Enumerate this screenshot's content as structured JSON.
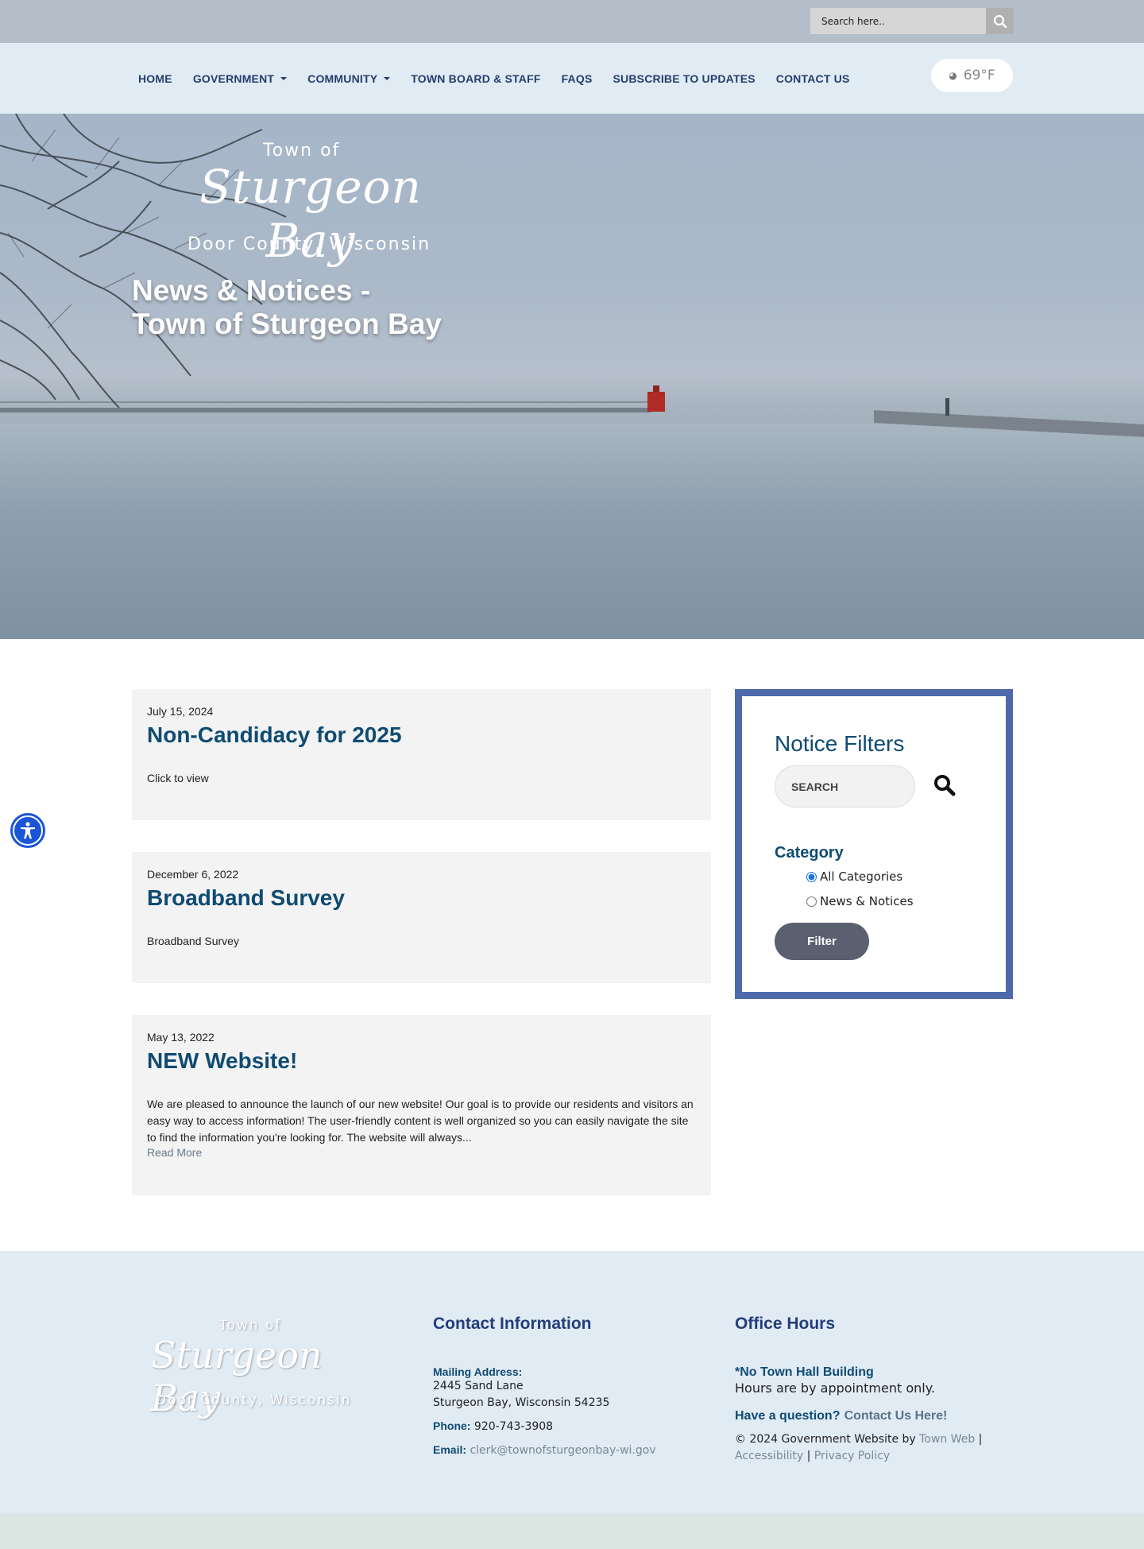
{
  "topbar": {
    "search_placeholder": "Search here.."
  },
  "nav": {
    "items": [
      {
        "label": "HOME",
        "dropdown": false
      },
      {
        "label": "GOVERNMENT",
        "dropdown": true
      },
      {
        "label": "COMMUNITY",
        "dropdown": true
      },
      {
        "label": "TOWN BOARD & STAFF",
        "dropdown": false
      },
      {
        "label": "FAQS",
        "dropdown": false
      },
      {
        "label": "SUBSCRIBE TO UPDATES",
        "dropdown": false
      },
      {
        "label": "CONTACT US",
        "dropdown": false
      }
    ],
    "weather": "69°F"
  },
  "hero": {
    "logo_town": "Town of",
    "logo_script": "Sturgeon Bay",
    "logo_county": "Door County, Wisconsin",
    "title_line1": "News & Notices -",
    "title_line2": "Town of Sturgeon Bay"
  },
  "posts": [
    {
      "date": "July 15, 2024",
      "title": "Non-Candidacy for 2025",
      "excerpt": "Click to view",
      "read_more": ""
    },
    {
      "date": "December 6, 2022",
      "title": "Broadband Survey",
      "excerpt": "Broadband Survey",
      "read_more": ""
    },
    {
      "date": "May 13, 2022",
      "title": "NEW Website!",
      "excerpt": "We are pleased to announce the launch of our new website! Our goal is to provide our residents and visitors an easy way to access information! The user-friendly content is well organized so you can easily navigate the site to find the information you're looking for. The website will always...",
      "read_more": "Read More"
    }
  ],
  "filters": {
    "title": "Notice Filters",
    "search_placeholder": "SEARCH",
    "category_label": "Category",
    "options": [
      {
        "label": "All Categories",
        "checked": true
      },
      {
        "label": "News & Notices",
        "checked": false
      }
    ],
    "button": "Filter"
  },
  "footer": {
    "logo_town": "Town of",
    "logo_script": "Sturgeon Bay",
    "logo_county": "Door County, Wisconsin",
    "contact": {
      "heading": "Contact Information",
      "mailing_label": "Mailing Address:",
      "address_line1": "2445 Sand Lane",
      "address_line2": "Sturgeon Bay, Wisconsin 54235",
      "phone_label": "Phone:",
      "phone": "920-743-3908",
      "email_label": "Email:",
      "email": "clerk@townofsturgeonbay-wi.gov"
    },
    "hours": {
      "heading": "Office Hours",
      "notice": "*No Town Hall Building",
      "text": "Hours are by appointment only.",
      "question": "Have a question?",
      "contact_link": "Contact Us Here!",
      "copyright": "© 2024 Government Website by",
      "townweb_link": "Town Web",
      "sep": "|",
      "accessibility_link": "Accessibility",
      "privacy_link": "Privacy Policy"
    }
  },
  "colors": {
    "nav_text": "#243d6b",
    "heading_blue": "#0f4b72",
    "filter_border": "#4e6aad",
    "footer_bg": "#e1ebf4",
    "accessibility_blue": "#1a55d6"
  }
}
